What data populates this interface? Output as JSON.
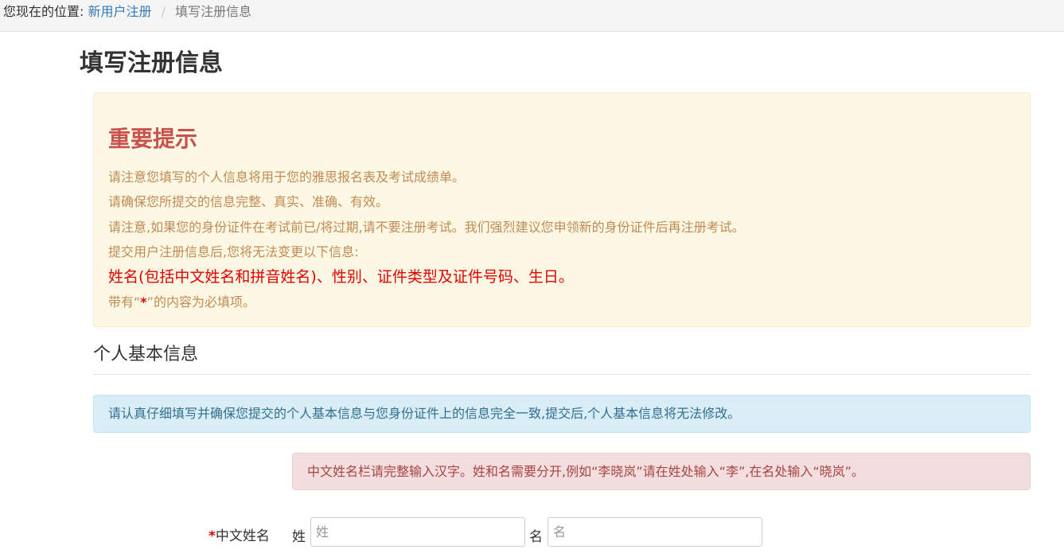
{
  "breadcrumb": {
    "prefix": "您现在的位置:",
    "link": "新用户注册",
    "separator": "/",
    "current": "填写注册信息"
  },
  "page_title": "填写注册信息",
  "notice": {
    "title": "重要提示",
    "line1": "请注意您填写的个人信息将用于您的雅思报名表及考试成绩单。",
    "line2": "请确保您所提交的信息完整、真实、准确、有效。",
    "line3": "请注意,如果您的身份证件在考试前已/将过期,请不要注册考试。我们强烈建议您申领新的身份证件后再注册考试。",
    "line4": "提交用户注册信息后,您将无法变更以下信息:",
    "line5": "姓名(包括中文姓名和拼音姓名)、性别、证件类型及证件号码、生日。",
    "line6_prefix": "带有“",
    "line6_star": "*",
    "line6_suffix": "”的内容为必填项。"
  },
  "section": {
    "title": "个人基本信息"
  },
  "info_alert": "请认真仔细填写并确保您提交的个人基本信息与您身份证件上的信息完全一致,提交后,个人基本信息将无法修改。",
  "name_alert": "中文姓名栏请完整输入汉字。姓和名需要分开,例如“李晓岚”请在姓处输入“李”,在名处输入“晓岚”。",
  "chinese_name": {
    "required_mark": "*",
    "label": "中文姓名",
    "surname_label": "姓",
    "surname_placeholder": "姓",
    "surname_value": "",
    "given_label": "名",
    "given_placeholder": "名",
    "given_value": ""
  },
  "colors": {
    "link": "#337ab7",
    "warning_bg": "#fcf8e3",
    "warning_title": "#c9524e",
    "required": "#e00000",
    "info_bg": "#d9edf7",
    "danger_bg": "#f2dede"
  }
}
